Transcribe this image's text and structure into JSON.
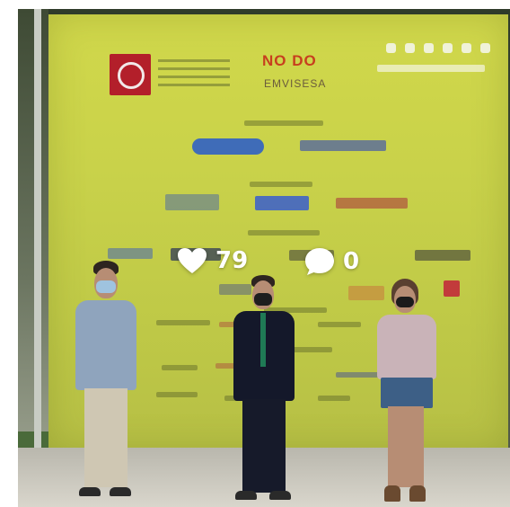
{
  "post": {
    "likes_count": "79",
    "comments_count": "0"
  },
  "icons": {
    "likes": "heart-icon",
    "comments": "speech-bubble-icon"
  },
  "colors": {
    "banner": "#c9d24a",
    "overlay_text": "#ffffff"
  }
}
